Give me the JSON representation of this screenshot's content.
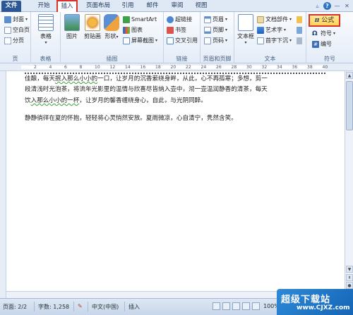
{
  "tabs": {
    "file": "文件",
    "home": "开始",
    "insert": "插入",
    "layout": "页面布局",
    "references": "引用",
    "mailings": "邮件",
    "review": "审阅",
    "view": "视图"
  },
  "ribbon": {
    "pages": {
      "cover": "封面",
      "blank": "空白页",
      "break": "分页",
      "label": "页"
    },
    "tables": {
      "table": "表格",
      "label": "表格"
    },
    "illustrations": {
      "picture": "图片",
      "clipart": "剪贴画",
      "shapes": "形状",
      "smartart": "SmartArt",
      "chart": "图表",
      "screenshot": "屏幕截图",
      "label": "插图"
    },
    "links": {
      "hyperlink": "超链接",
      "bookmark": "书签",
      "crossref": "交叉引用",
      "label": "链接"
    },
    "headerfooter": {
      "header": "页眉",
      "footer": "页脚",
      "pagenum": "页码",
      "label": "页眉和页脚"
    },
    "text": {
      "textbox": "文本框",
      "quickparts": "文档部件",
      "wordart": "艺术字",
      "dropcap": "首字下沉",
      "label": "文本"
    },
    "symbols": {
      "equation": "公式",
      "equation_glyph": "π",
      "symbol": "符号",
      "numbering": "编号",
      "label": "符号"
    }
  },
  "ruler": [
    "2",
    "4",
    "6",
    "8",
    "10",
    "12",
    "14",
    "16",
    "18",
    "20",
    "22",
    "24",
    "26",
    "28",
    "30",
    "32",
    "34",
    "36",
    "38",
    "40"
  ],
  "document": {
    "line1_a": "佳酿，每天",
    "line1_b": "抿入那么小小的",
    "line1_c": "一口，让岁月的沉香萦绕身畔，从此，心不再孤寒；多想，剪一",
    "line2": "段清浅时光泡茶，将流年光影里的温情与欣喜尽皆纳入壶中，沏一壶温润静香的清茶，每天",
    "line3_a": "饮",
    "line3_b": "入那么小小的一杯",
    "line3_c": "，让岁月的馨香缠绕身心，自此，与光阴同醉。",
    "para2": "静静徜徉在夏的怀抱，轻轻将心灵悄然安放。夏雨微凉，心自清宁，隽然含笑。"
  },
  "status": {
    "page": "页面: 2/2",
    "words": "字数: 1,258",
    "language": "中文(中国)",
    "mode": "插入",
    "zoom": "100%"
  },
  "watermark": {
    "line1": "超级下载站",
    "line2": "www.CJXZ.com"
  },
  "colors": {
    "accent_red": "#d8322b",
    "file_tab": "#2b5797",
    "ribbon_bg": "#e4ecf7"
  }
}
